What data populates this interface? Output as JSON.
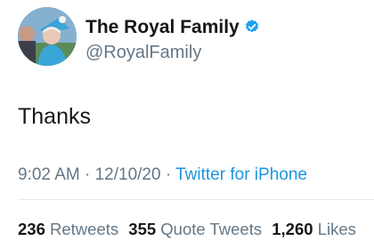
{
  "user": {
    "display_name": "The Royal Family",
    "handle": "@RoyalFamily",
    "verified": true,
    "verified_color": "#1da1f2",
    "avatar_icon": "profile-photo"
  },
  "tweet": {
    "text": "Thanks",
    "time": "9:02 AM",
    "date": "12/10/20",
    "source": "Twitter for iPhone",
    "separator": "·"
  },
  "stats": {
    "retweets_count": "236",
    "retweets_label": "Retweets",
    "quotes_count": "355",
    "quotes_label": "Quote Tweets",
    "likes_count": "1,260",
    "likes_label": "Likes"
  },
  "colors": {
    "primary_text": "#14171a",
    "secondary_text": "#657786",
    "link": "#1b95e0",
    "divider": "#e1e8ed"
  }
}
